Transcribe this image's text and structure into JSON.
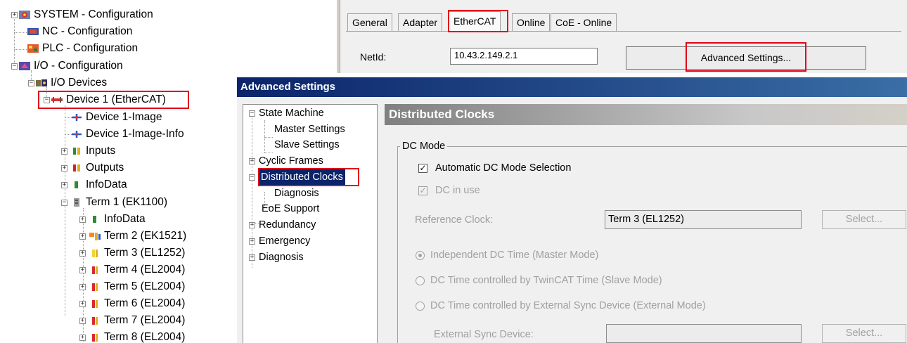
{
  "tree": {
    "system": "SYSTEM - Configuration",
    "nc": "NC - Configuration",
    "plc": "PLC - Configuration",
    "io": "I/O - Configuration",
    "io_devices": "I/O Devices",
    "device1": "Device 1 (EtherCAT)",
    "device1_image": "Device 1-Image",
    "device1_image_info": "Device 1-Image-Info",
    "inputs": "Inputs",
    "outputs": "Outputs",
    "infodata": "InfoData",
    "term1": "Term 1 (EK1100)",
    "term1_infodata": "InfoData",
    "terms": [
      "Term 2 (EK1521)",
      "Term 3 (EL1252)",
      "Term 4 (EL2004)",
      "Term 5 (EL2004)",
      "Term 6 (EL2004)",
      "Term 7 (EL2004)",
      "Term 8 (EL2004)"
    ]
  },
  "panel": {
    "tabs": [
      "General",
      "Adapter",
      "EtherCAT",
      "Online",
      "CoE - Online"
    ],
    "active_tab": "EtherCAT",
    "netid_label": "NetId:",
    "netid_value": "10.43.2.149.2.1",
    "advanced_button": "Advanced Settings..."
  },
  "dialog": {
    "title": "Advanced Settings",
    "nav": {
      "state_machine": "State Machine",
      "master_settings": "Master Settings",
      "slave_settings": "Slave Settings",
      "cyclic_frames": "Cyclic Frames",
      "distributed_clocks": "Distributed Clocks",
      "diagnosis_sub": "Diagnosis",
      "eoe_support": "EoE Support",
      "redundancy": "Redundancy",
      "emergency": "Emergency",
      "diagnosis": "Diagnosis"
    },
    "section_title": "Distributed Clocks",
    "group_label": "DC Mode",
    "auto_dc_label": "Automatic DC Mode Selection",
    "dc_in_use_label": "DC in use",
    "reference_clock_label": "Reference Clock:",
    "reference_clock_value": "Term 3 (EL1252)",
    "select_label": "Select...",
    "radio_master": "Independent DC Time (Master Mode)",
    "radio_slave": "DC Time controlled by TwinCAT Time (Slave Mode)",
    "radio_external": "DC Time controlled by External Sync Device (External Mode)",
    "external_sync_label": "External Sync Device:",
    "external_sync_value": ""
  },
  "colors": {
    "highlight_red": "#e0001b",
    "title_blue": "#0b246a",
    "selection_blue": "#0a246a"
  }
}
